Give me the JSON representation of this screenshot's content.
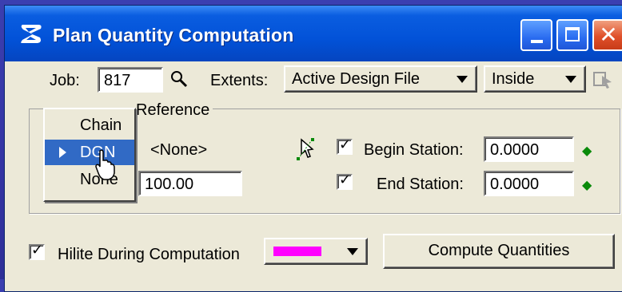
{
  "window": {
    "title": "Plan Quantity Computation"
  },
  "job": {
    "label": "Job:",
    "value": "817"
  },
  "extents": {
    "label": "Extents:",
    "scope": "Active Design File",
    "mode": "Inside"
  },
  "reference_group": {
    "label": "Reference"
  },
  "reference": {
    "value": "<None>",
    "interval": "100.00"
  },
  "begin_station": {
    "label": "Begin Station:",
    "value": "0.0000",
    "checked": true
  },
  "end_station": {
    "label": "End Station:",
    "value": "0.0000",
    "checked": true
  },
  "hilite": {
    "label": "Hilite During Computation",
    "checked": true,
    "color": "#ff00ff"
  },
  "compute_button": {
    "label": "Compute Quantities"
  },
  "menu": {
    "items": [
      "Chain",
      "DGN",
      "None"
    ],
    "selected": "DGN"
  },
  "colors": {
    "titlebar": "#0252d8",
    "selection": "#316ac5",
    "dialog": "#ece9d8"
  },
  "icons": [
    "app-logo-icon",
    "search-icon",
    "locate-icon",
    "select-element-icon",
    "station-target-icon",
    "minimize-icon",
    "maximize-icon",
    "close-icon"
  ]
}
